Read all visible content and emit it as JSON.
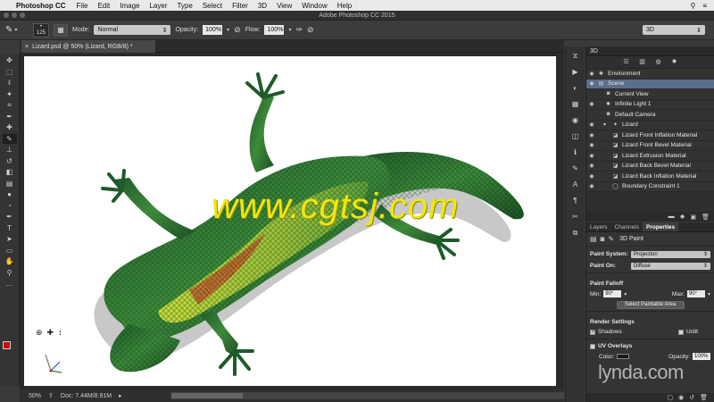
{
  "menubar": {
    "app": "Photoshop CC",
    "items": [
      "File",
      "Edit",
      "Image",
      "Layer",
      "Type",
      "Select",
      "Filter",
      "3D",
      "View",
      "Window",
      "Help"
    ]
  },
  "window": {
    "title": "Adobe Photoshop CC 2015"
  },
  "options": {
    "brush_size": "125",
    "mode_label": "Mode:",
    "mode_value": "Normal",
    "opacity_label": "Opacity:",
    "opacity_value": "100%",
    "flow_label": "Flow:",
    "flow_value": "100%",
    "workspace": "3D"
  },
  "document": {
    "tab_title": "Lizard.psd @ 50% (Lizard, RGB/8) *",
    "watermark": "www.cgtsj.com"
  },
  "status": {
    "zoom": "50%",
    "doc": "Doc: 7.44M/8.91M"
  },
  "panel3d": {
    "title": "3D",
    "rows": [
      {
        "label": "Environment",
        "indent": 0,
        "icon": "globe-icon"
      },
      {
        "label": "Scene",
        "indent": 0,
        "icon": "scene-icon",
        "selected": true
      },
      {
        "label": "Current View",
        "indent": 1,
        "icon": "camera-icon"
      },
      {
        "label": "Infinite Light 1",
        "indent": 1,
        "icon": "light-icon"
      },
      {
        "label": "Default Camera",
        "indent": 1,
        "icon": "camera-icon"
      },
      {
        "label": "Lizard",
        "indent": 1,
        "icon": "mesh-icon"
      },
      {
        "label": "Lizard Front Inflation Material",
        "indent": 2,
        "icon": "material-icon"
      },
      {
        "label": "Lizard Front Bevel Material",
        "indent": 2,
        "icon": "material-icon"
      },
      {
        "label": "Lizard Extrusion Material",
        "indent": 2,
        "icon": "material-icon"
      },
      {
        "label": "Lizard Back Bevel Material",
        "indent": 2,
        "icon": "material-icon"
      },
      {
        "label": "Lizard Back Inflation Material",
        "indent": 2,
        "icon": "material-icon"
      },
      {
        "label": "Boundary Constraint 1",
        "indent": 2,
        "icon": "constraint-icon"
      }
    ]
  },
  "properties": {
    "tabs": [
      "Layers",
      "Channels",
      "Properties"
    ],
    "active_tab": "Properties",
    "section_title": "3D Paint",
    "paint_system_label": "Paint System:",
    "paint_system_value": "Projection",
    "paint_on_label": "Paint On:",
    "paint_on_value": "Diffuse",
    "falloff_title": "Paint Falloff",
    "min_label": "Min:",
    "min_value": "90°",
    "max_label": "Max:",
    "max_value": "90°",
    "select_area_button": "Select Paintable Area",
    "render_settings_title": "Render Settings",
    "shadows_label": "Shadows",
    "shadows_checked": true,
    "unlit_label": "Unlit",
    "unlit_checked": false,
    "uv_overlays_label": "UV Overlays",
    "color_label": "Color:",
    "opacity_label": "Opacity:",
    "opacity_value": "100%"
  },
  "brand": {
    "watermark": "lynda.com"
  }
}
